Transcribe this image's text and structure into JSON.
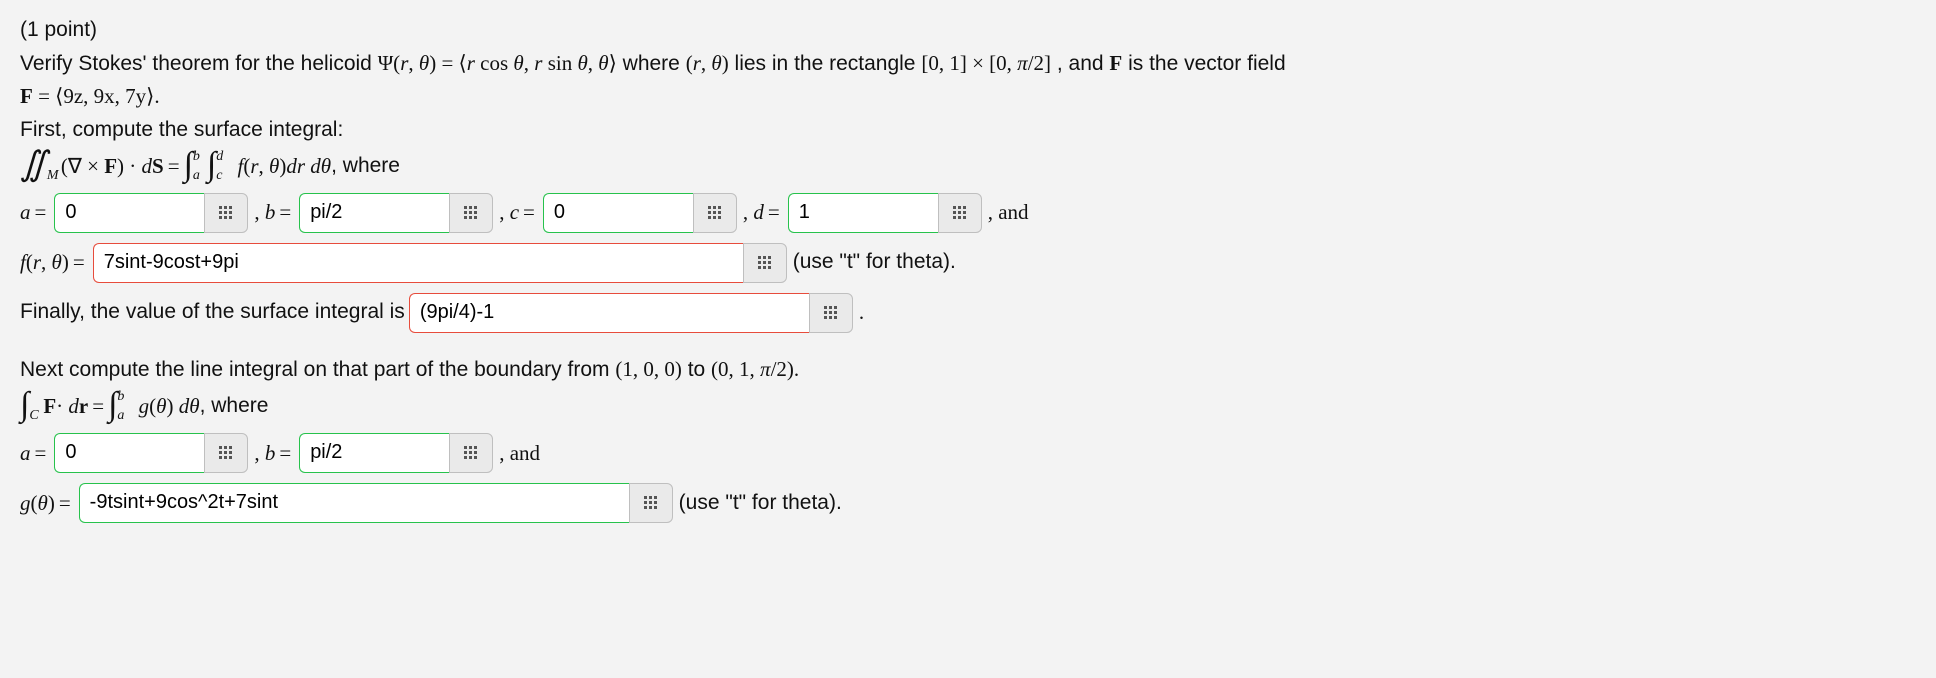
{
  "points_line": "(1 point)",
  "prompt_prefix": "Verify Stokes' theorem for the helicoid ",
  "prompt_mid1": " where ",
  "prompt_mid2": " lies in the rectangle ",
  "prompt_mid3": ", and ",
  "prompt_mid4": " is the vector field",
  "f_vec": " = ⟨9z, 9x, 7y⟩.",
  "first_line": "First, compute the surface integral:",
  "int_tail": ", where",
  "labels": {
    "a": "a = ",
    "b": "b = ",
    "c": "c = ",
    "d": "d = ",
    "and": ", and",
    "comma": ", ",
    "period": "."
  },
  "surface": {
    "a": {
      "value": "0",
      "correct": true
    },
    "b": {
      "value": "pi/2",
      "correct": true
    },
    "c": {
      "value": "0",
      "correct": true
    },
    "d": {
      "value": "1",
      "correct": true
    },
    "f": {
      "value": "7sint-9cost+9pi",
      "correct": false
    },
    "val": {
      "value": "(9pi/4)-1",
      "correct": false
    }
  },
  "f_label_pre": "f(r, θ) = ",
  "theta_note": "(use \"t\" for theta).",
  "final_line": "Finally, the value of the surface integral is ",
  "next_line_pre": "Next compute the line integral on that part of the boundary from ",
  "pt1": "(1, 0, 0)",
  "to": " to ",
  "pt2": "(0, 1, π/2).",
  "line_tail": ", where",
  "line": {
    "a": {
      "value": "0",
      "correct": true
    },
    "b": {
      "value": "pi/2",
      "correct": true
    },
    "g": {
      "value": "-9tsint+9cos^2t+7sint",
      "correct": true
    }
  },
  "g_label_pre": "g(θ) = "
}
